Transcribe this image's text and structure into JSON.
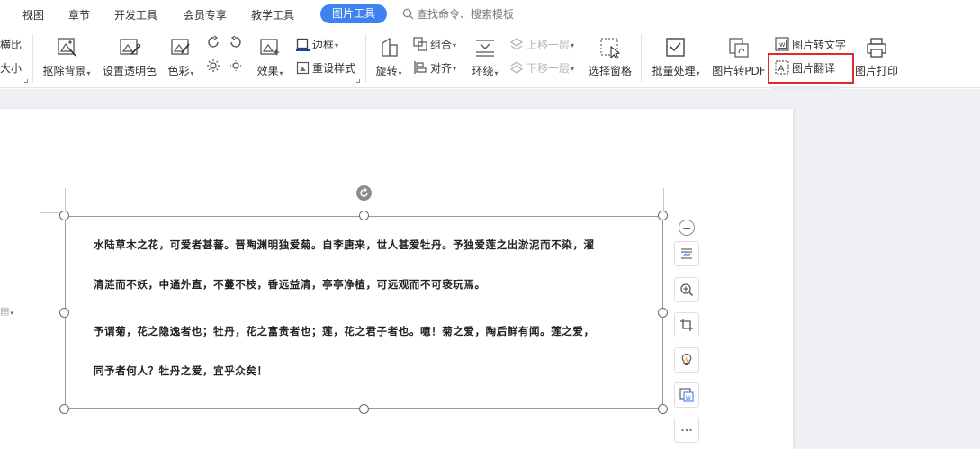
{
  "tabs": [
    {
      "label": "视图"
    },
    {
      "label": "章节"
    },
    {
      "label": "开发工具"
    },
    {
      "label": "会员专享"
    },
    {
      "label": "教学工具"
    },
    {
      "label": "图片工具",
      "active": true
    }
  ],
  "search": {
    "placeholder": "查找命令、搜索模板"
  },
  "ribbon": {
    "crop_partial_top": "横比",
    "crop_partial_bottom": "大小",
    "remove_bg": "抠除背景",
    "set_transparent": "设置透明色",
    "color": "色彩",
    "effects": "效果",
    "border": "边框",
    "reset_style": "重设样式",
    "rotate": "旋转",
    "group": "组合",
    "align": "对齐",
    "wrap": "环绕",
    "bring_forward": "上移一层",
    "send_backward": "下移一层",
    "selection_pane": "选择窗格",
    "batch": "批量处理",
    "to_pdf": "图片转PDF",
    "to_text": "图片转文字",
    "translate": "图片翻译",
    "print": "图片打印"
  },
  "document": {
    "lines": [
      "水陆草木之花，可爱者甚蕃。晋陶渊明独爱菊。自李唐来，世人甚爱牡丹。予独爱莲之出淤泥而不染，濯",
      "清涟而不妖，中通外直，不蔓不枝，香远益清，亭亭净植，可远观而不可亵玩焉。",
      "予谓菊，花之隐逸者也；牡丹，花之富贵者也；莲，花之君子者也。噫！菊之爱，陶后鲜有闻。莲之爱，",
      "同予者何人？牡丹之爱，宜乎众矣！"
    ]
  },
  "colors": {
    "accent": "#3d82f0",
    "highlight": "#e02b2b"
  }
}
